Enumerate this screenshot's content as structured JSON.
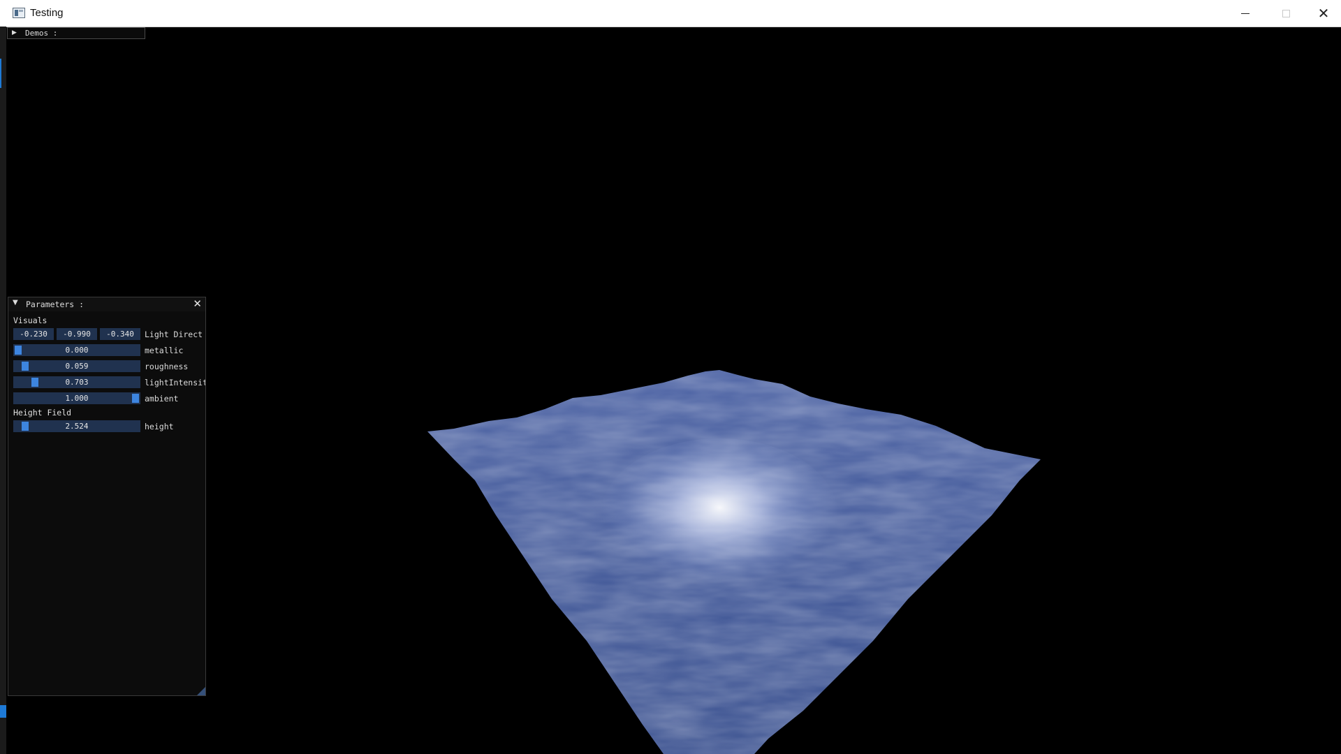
{
  "window": {
    "title": "Testing",
    "controls": {
      "minimize": "minimize-icon",
      "maximize": "maximize-icon",
      "close": "close-icon"
    }
  },
  "demos_panel": {
    "title": "Demos :",
    "collapsed": true
  },
  "parameters_panel": {
    "title": "Parameters :",
    "sections": {
      "visuals": "Visuals",
      "height_field": "Height Field"
    },
    "light_direction": {
      "label": "Light Direct",
      "x": "-0.230",
      "y": "-0.990",
      "z": "-0.340"
    },
    "sliders": [
      {
        "label": "metallic",
        "value": "0.000",
        "fraction": 0.0
      },
      {
        "label": "roughness",
        "value": "0.059",
        "fraction": 0.059
      },
      {
        "label": "lightIntensit",
        "value": "0.703",
        "fraction": 0.14
      },
      {
        "label": "ambient",
        "value": "1.000",
        "fraction": 1.0
      },
      {
        "label": "height",
        "value": "2.524",
        "fraction": 0.06
      }
    ]
  },
  "colors": {
    "background": "#000000",
    "terrain": "#4a5f9c",
    "slider_bg": "#20324f",
    "slider_grab": "#3d85e0"
  }
}
